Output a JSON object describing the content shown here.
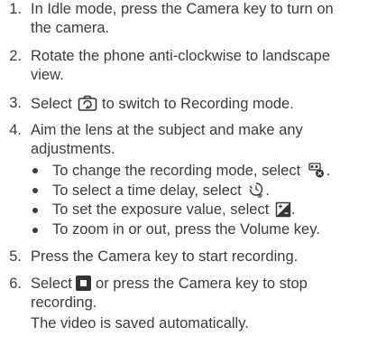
{
  "steps": [
    {
      "num": "1.",
      "line1": "In Idle mode, press the Camera key to turn on",
      "line2": "the camera."
    },
    {
      "num": "2.",
      "line1": "Rotate the phone anti-clockwise to landscape",
      "line2": "view."
    },
    {
      "num": "3.",
      "pre": "Select",
      "post": "to switch to Recording mode.",
      "icon": "camera-switch-icon"
    },
    {
      "num": "4.",
      "line1": "Aim the lens at the subject and make any",
      "line2": "adjustments."
    },
    {
      "num": "5.",
      "line1": "Press the Camera key to start recording."
    },
    {
      "num": "6.",
      "pre": "Select",
      "post": "or press the Camera key to stop",
      "line2": "recording.",
      "icon": "stop-icon"
    }
  ],
  "bullets": [
    {
      "text": "To change the recording mode, select",
      "end": ".",
      "icon": "recording-mode-icon"
    },
    {
      "text": "To select a time delay, select",
      "end": ".",
      "icon": "timer-icon"
    },
    {
      "text": "To set the exposure value, select",
      "end": ".",
      "icon": "exposure-icon"
    },
    {
      "text": "To zoom in or out, press the Volume key.",
      "end": ""
    }
  ],
  "note": "The video is saved automatically."
}
